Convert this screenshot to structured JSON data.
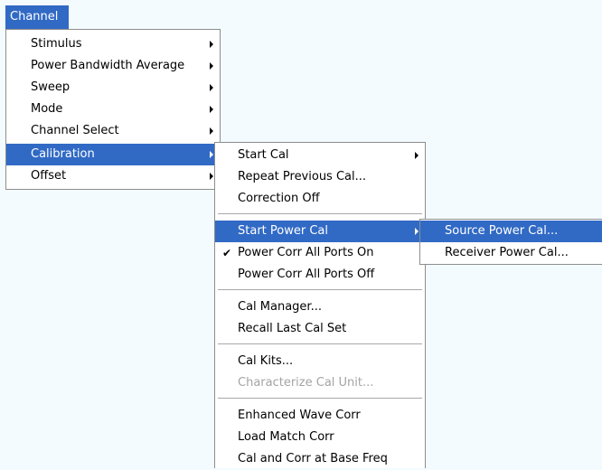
{
  "menubar": {
    "channel_label": "Channel"
  },
  "channel_menu": {
    "items": [
      {
        "label": "Stimulus",
        "submenu": true
      },
      {
        "label": "Power Bandwidth Average",
        "submenu": true
      },
      {
        "label": "Sweep",
        "submenu": true
      },
      {
        "label": "Mode",
        "submenu": true
      },
      {
        "label": "Channel Select",
        "submenu": true
      },
      {
        "label": "Calibration",
        "submenu": true,
        "highlighted": true
      },
      {
        "label": "Offset",
        "submenu": true
      }
    ]
  },
  "calibration_menu": {
    "items": [
      {
        "label": "Start Cal",
        "submenu": true
      },
      {
        "label": "Repeat Previous Cal..."
      },
      {
        "label": "Correction Off"
      },
      {
        "label": "Start Power Cal",
        "submenu": true,
        "highlighted": true
      },
      {
        "label": "Power Corr All Ports On",
        "checked": true
      },
      {
        "label": "Power Corr All Ports Off"
      },
      {
        "label": "Cal Manager..."
      },
      {
        "label": "Recall Last Cal Set"
      },
      {
        "label": "Cal Kits..."
      },
      {
        "label": "Characterize Cal Unit...",
        "disabled": true
      },
      {
        "label": "Enhanced Wave Corr"
      },
      {
        "label": "Load Match Corr"
      },
      {
        "label": "Cal and Corr at Base Freq"
      }
    ]
  },
  "power_cal_menu": {
    "items": [
      {
        "label": "Source Power Cal...",
        "highlighted": true
      },
      {
        "label": "Receiver Power Cal..."
      }
    ]
  },
  "icons": {
    "submenu": "arrow-right-icon",
    "check": "checkmark-icon"
  },
  "colors": {
    "highlight": "#316ac5",
    "background": "#f3fbff",
    "disabled_text": "#a4a4a4"
  }
}
